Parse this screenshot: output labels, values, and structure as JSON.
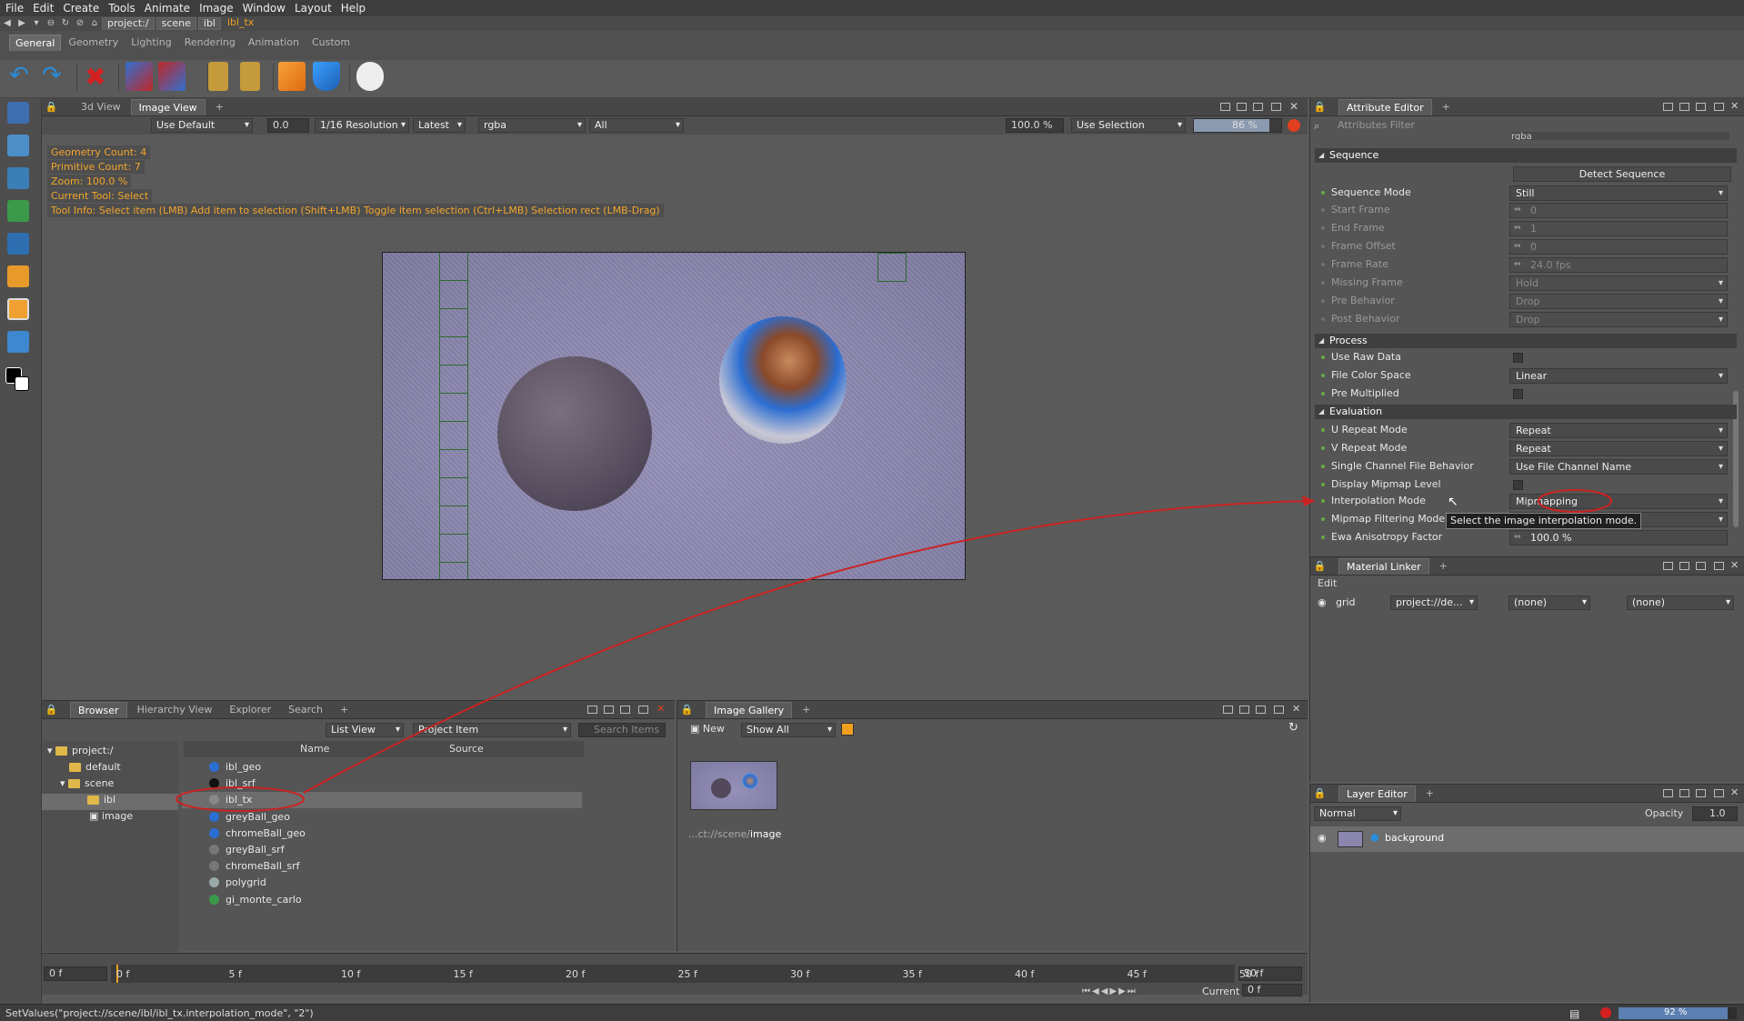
{
  "menu": [
    "File",
    "Edit",
    "Create",
    "Tools",
    "Animate",
    "Image",
    "Window",
    "Layout",
    "Help"
  ],
  "path": {
    "crumbs": [
      "project:/",
      "scene",
      "ibl"
    ],
    "current": "ibl_tx"
  },
  "shelf_tabs": [
    "General",
    "Geometry",
    "Lighting",
    "Rendering",
    "Animation",
    "Custom"
  ],
  "viewer": {
    "tabs": [
      "3d View",
      "Image View"
    ],
    "display": "Use Default",
    "exposure": "0.0",
    "resolution": "1/16 Resolution",
    "version": "Latest",
    "channels": "rgba",
    "layer": "All",
    "zoom": "100.0 %",
    "selection": "Use Selection",
    "progress_label": "86 %",
    "progress_value": 0.86,
    "hud": [
      "Geometry Count: 4",
      "Primitive Count: 7",
      "Zoom: 100.0 %",
      "Current Tool: Select",
      "Tool Info: Select item (LMB)  Add item to selection (Shift+LMB)  Toggle item selection (Ctrl+LMB)  Selection rect (LMB-Drag)"
    ]
  },
  "attribute_editor": {
    "tab": "Attribute Editor",
    "filter_placeholder": "Attributes Filter",
    "top_value": "rgba",
    "sections": {
      "sequence": "Sequence",
      "process": "Process",
      "evaluation": "Evaluation"
    },
    "detect_sequence": "Detect Sequence",
    "rows": [
      {
        "label": "Sequence Mode",
        "value": "Still"
      },
      {
        "label": "Start Frame",
        "value": "0"
      },
      {
        "label": "End Frame",
        "value": "1"
      },
      {
        "label": "Frame Offset",
        "value": "0"
      },
      {
        "label": "Frame Rate",
        "value": "24.0 fps"
      },
      {
        "label": "Missing Frame",
        "value": "Hold"
      },
      {
        "label": "Pre Behavior",
        "value": "Drop"
      },
      {
        "label": "Post Behavior",
        "value": "Drop"
      },
      {
        "label": "Use Raw Data",
        "value": ""
      },
      {
        "label": "File Color Space",
        "value": "Linear"
      },
      {
        "label": "Pre Multiplied",
        "value": ""
      },
      {
        "label": "U Repeat Mode",
        "value": "Repeat"
      },
      {
        "label": "V Repeat Mode",
        "value": "Repeat"
      },
      {
        "label": "Single Channel File Behavior",
        "value": "Use File Channel Name"
      },
      {
        "label": "Display Mipmap Level",
        "value": ""
      },
      {
        "label": "Interpolation Mode",
        "value": "Mipmapping"
      },
      {
        "label": "Mipmap Filtering Mode",
        "value": ""
      },
      {
        "label": "Ewa Anisotropy Factor",
        "value": "100.0 %"
      }
    ],
    "tooltip": "Select the image interpolation mode."
  },
  "material_linker": {
    "tab": "Material Linker",
    "edit": "Edit",
    "item": "grid",
    "project": "project://de...",
    "none1": "(none)",
    "none2": "(none)"
  },
  "layer_editor": {
    "tab": "Layer Editor",
    "blend": "Normal",
    "opacity_label": "Opacity",
    "opacity": "1.0",
    "layer": "background"
  },
  "browser": {
    "tabs": [
      "Browser",
      "Hierarchy View",
      "Explorer",
      "Search"
    ],
    "view_mode": "List View",
    "filter": "Project Item",
    "search_placeholder": "Search Items",
    "tree": [
      "project:/",
      "default",
      "scene",
      "ibl",
      "image"
    ],
    "columns": [
      "Name",
      "Source"
    ],
    "items": [
      "ibl_geo",
      "ibl_srf",
      "ibl_tx",
      "greyBall_geo",
      "chromeBall_geo",
      "greyBall_srf",
      "chromeBall_srf",
      "polygrid",
      "gi_monte_carlo"
    ]
  },
  "gallery": {
    "tab": "Image Gallery",
    "new": "New",
    "show": "Show All",
    "caption_prefix": "...ct://scene/",
    "caption_name": "image"
  },
  "timeline": {
    "start": "0 f",
    "end": "50 f",
    "ticks": [
      "0 f",
      "5 f",
      "10 f",
      "15 f",
      "20 f",
      "25 f",
      "30 f",
      "35 f",
      "40 f",
      "45 f",
      "50 f"
    ],
    "current_label": "Current",
    "current": "0 f"
  },
  "status": {
    "text": "SetValues(\"project://scene/ibl/ibl_tx.interpolation_mode\", \"2\")",
    "progress": "92 %",
    "progress_value": 0.92
  },
  "colors": {
    "accent": "#f3a52b",
    "annotation": "#cc2222",
    "selection": "#6d6d6d"
  }
}
